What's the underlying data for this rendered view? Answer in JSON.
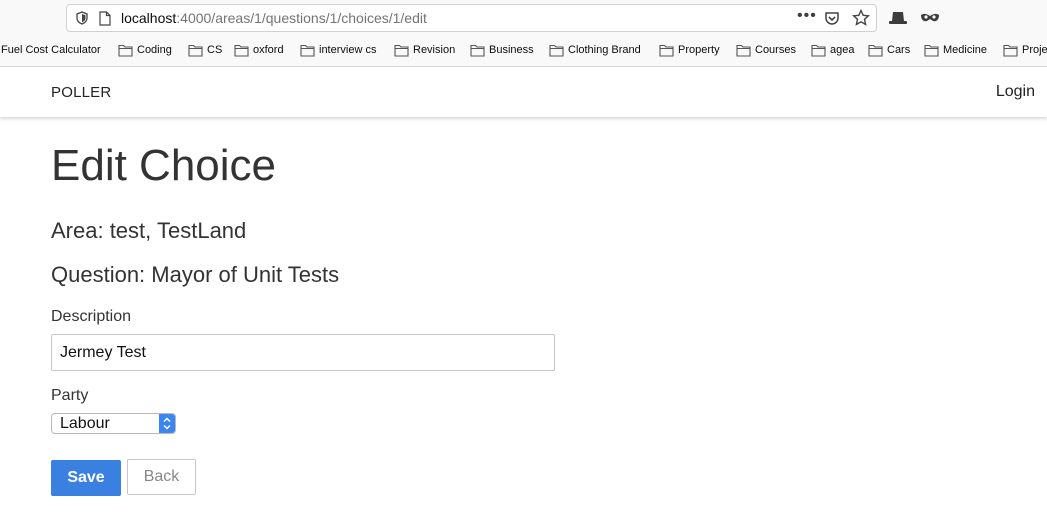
{
  "browser": {
    "url_host": "localhost",
    "url_path": ":4000/areas/1/questions/1/choices/1/edit",
    "more_label": "•••"
  },
  "bookmarks": [
    {
      "label": "Fuel Cost Calculator",
      "folder": false
    },
    {
      "label": "Coding",
      "folder": true
    },
    {
      "label": "CS",
      "folder": true
    },
    {
      "label": "oxford",
      "folder": true
    },
    {
      "label": "interview cs",
      "folder": true
    },
    {
      "label": "Revision",
      "folder": true
    },
    {
      "label": "Business",
      "folder": true
    },
    {
      "label": "Clothing Brand",
      "folder": true
    },
    {
      "label": "Property",
      "folder": true
    },
    {
      "label": "Courses",
      "folder": true
    },
    {
      "label": "agea",
      "folder": true
    },
    {
      "label": "Cars",
      "folder": true
    },
    {
      "label": "Medicine",
      "folder": true
    },
    {
      "label": "Proje",
      "folder": true
    }
  ],
  "navbar": {
    "brand": "POLLER",
    "login": "Login"
  },
  "page": {
    "title": "Edit Choice",
    "area": "Area: test, TestLand",
    "question": "Question: Mayor of Unit Tests"
  },
  "form": {
    "description_label": "Description",
    "description_value": "Jermey Test",
    "party_label": "Party",
    "party_value": "Labour",
    "save_label": "Save",
    "back_label": "Back"
  },
  "colors": {
    "primary": "#3a80e0",
    "select_caret": "#3a86f5"
  }
}
